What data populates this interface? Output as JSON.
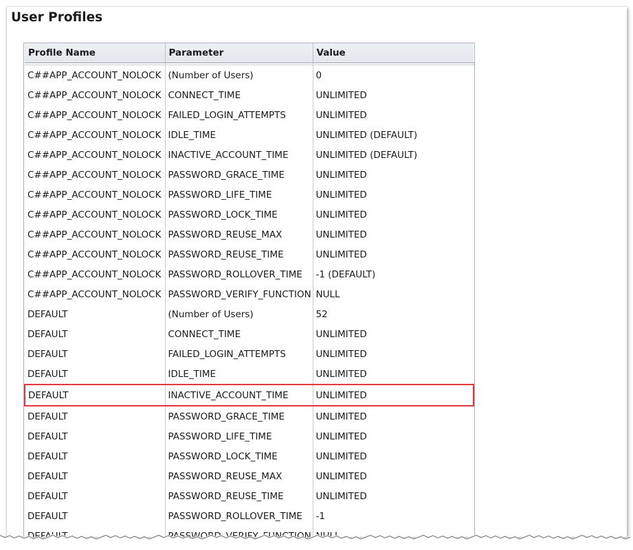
{
  "page": {
    "title": "User Profiles"
  },
  "table": {
    "columns": [
      "Profile Name",
      "Parameter",
      "Value"
    ],
    "rows": [
      {
        "profile": "C##APP_ACCOUNT_NOLOCK",
        "parameter": "(Number of Users)",
        "value": "0"
      },
      {
        "profile": "C##APP_ACCOUNT_NOLOCK",
        "parameter": "CONNECT_TIME",
        "value": "UNLIMITED"
      },
      {
        "profile": "C##APP_ACCOUNT_NOLOCK",
        "parameter": "FAILED_LOGIN_ATTEMPTS",
        "value": "UNLIMITED"
      },
      {
        "profile": "C##APP_ACCOUNT_NOLOCK",
        "parameter": "IDLE_TIME",
        "value": "UNLIMITED (DEFAULT)"
      },
      {
        "profile": "C##APP_ACCOUNT_NOLOCK",
        "parameter": "INACTIVE_ACCOUNT_TIME",
        "value": "UNLIMITED (DEFAULT)"
      },
      {
        "profile": "C##APP_ACCOUNT_NOLOCK",
        "parameter": "PASSWORD_GRACE_TIME",
        "value": "UNLIMITED"
      },
      {
        "profile": "C##APP_ACCOUNT_NOLOCK",
        "parameter": "PASSWORD_LIFE_TIME",
        "value": "UNLIMITED"
      },
      {
        "profile": "C##APP_ACCOUNT_NOLOCK",
        "parameter": "PASSWORD_LOCK_TIME",
        "value": "UNLIMITED"
      },
      {
        "profile": "C##APP_ACCOUNT_NOLOCK",
        "parameter": "PASSWORD_REUSE_MAX",
        "value": "UNLIMITED"
      },
      {
        "profile": "C##APP_ACCOUNT_NOLOCK",
        "parameter": "PASSWORD_REUSE_TIME",
        "value": "UNLIMITED"
      },
      {
        "profile": "C##APP_ACCOUNT_NOLOCK",
        "parameter": "PASSWORD_ROLLOVER_TIME",
        "value": "-1 (DEFAULT)"
      },
      {
        "profile": "C##APP_ACCOUNT_NOLOCK",
        "parameter": "PASSWORD_VERIFY_FUNCTION",
        "value": "NULL"
      },
      {
        "profile": "DEFAULT",
        "parameter": "(Number of Users)",
        "value": "52"
      },
      {
        "profile": "DEFAULT",
        "parameter": "CONNECT_TIME",
        "value": "UNLIMITED"
      },
      {
        "profile": "DEFAULT",
        "parameter": "FAILED_LOGIN_ATTEMPTS",
        "value": "UNLIMITED"
      },
      {
        "profile": "DEFAULT",
        "parameter": "IDLE_TIME",
        "value": "UNLIMITED"
      },
      {
        "profile": "DEFAULT",
        "parameter": "INACTIVE_ACCOUNT_TIME",
        "value": "UNLIMITED",
        "highlighted": true
      },
      {
        "profile": "DEFAULT",
        "parameter": "PASSWORD_GRACE_TIME",
        "value": "UNLIMITED"
      },
      {
        "profile": "DEFAULT",
        "parameter": "PASSWORD_LIFE_TIME",
        "value": "UNLIMITED"
      },
      {
        "profile": "DEFAULT",
        "parameter": "PASSWORD_LOCK_TIME",
        "value": "UNLIMITED"
      },
      {
        "profile": "DEFAULT",
        "parameter": "PASSWORD_REUSE_MAX",
        "value": "UNLIMITED"
      },
      {
        "profile": "DEFAULT",
        "parameter": "PASSWORD_REUSE_TIME",
        "value": "UNLIMITED"
      },
      {
        "profile": "DEFAULT",
        "parameter": "PASSWORD_ROLLOVER_TIME",
        "value": "-1"
      },
      {
        "profile": "DEFAULT",
        "parameter": "PASSWORD_VERIFY_FUNCTION",
        "value": "NULL"
      }
    ]
  },
  "colors": {
    "highlight_border": "#e3353b",
    "header_bg": "#e8ecf0",
    "grid_line": "#c6cdd4"
  }
}
